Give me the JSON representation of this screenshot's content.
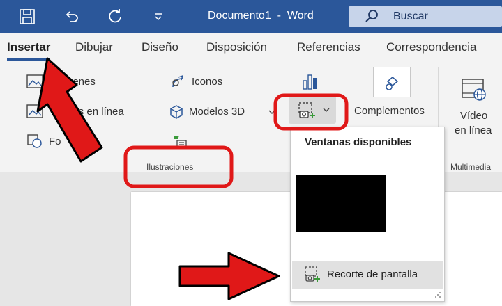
{
  "titlebar": {
    "document_title": "Documento1  -  Word",
    "search_label": "Buscar"
  },
  "tabs": [
    {
      "label": "Insertar",
      "active": true
    },
    {
      "label": "Dibujar"
    },
    {
      "label": "Diseño"
    },
    {
      "label": "Disposición"
    },
    {
      "label": "Referencias"
    },
    {
      "label": "Correspondencia"
    }
  ],
  "ribbon": {
    "illustrations": {
      "imagenes_visible": "genes",
      "imagenes_en_linea_visible": "nes en línea",
      "formas_visible": "Fo",
      "iconos": "Iconos",
      "modelos_3d": "Modelos 3D",
      "group_label": "Ilustraciones"
    },
    "complementos": "Complementos",
    "video": {
      "line1": "Vídeo",
      "line2": "en línea"
    },
    "multimedia_label": "Multimedia"
  },
  "screenshot_menu": {
    "title": "Ventanas disponibles",
    "item_label": "Recorte de pantalla"
  },
  "colors": {
    "title_bar": "#2b579a",
    "annotation_red": "#e01818"
  }
}
